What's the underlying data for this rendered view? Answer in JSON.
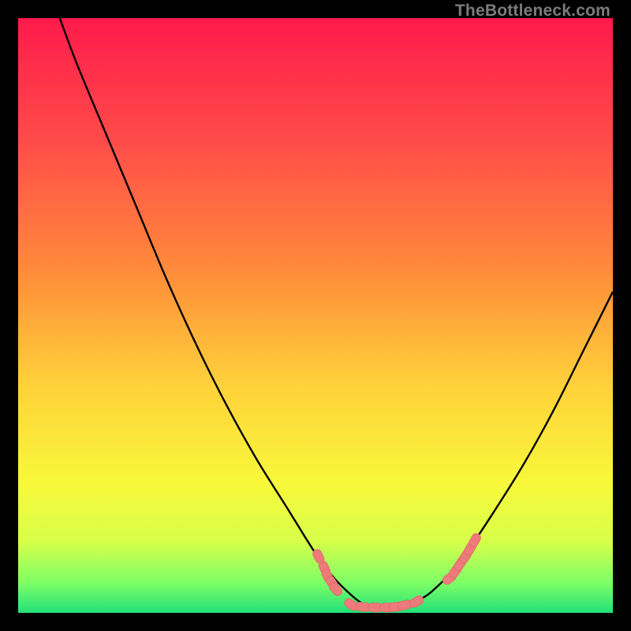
{
  "watermark": "TheBottleneck.com",
  "chart_data": {
    "type": "line",
    "title": "",
    "xlabel": "",
    "ylabel": "",
    "xlim": [
      0,
      100
    ],
    "ylim": [
      0,
      100
    ],
    "series": [
      {
        "name": "curve",
        "x": [
          7,
          10,
          15,
          20,
          25,
          30,
          35,
          40,
          45,
          50,
          53,
          56,
          58,
          60,
          62,
          65,
          68,
          70,
          73,
          76,
          80,
          85,
          90,
          95,
          100
        ],
        "y": [
          100,
          92,
          80,
          68,
          56,
          45,
          35,
          26,
          18,
          10,
          6,
          3,
          1.5,
          0.8,
          0.8,
          1.2,
          2.5,
          4,
          7,
          11,
          17,
          25,
          34,
          44,
          54
        ]
      }
    ],
    "marker_cluster": {
      "name": "dots",
      "points": [
        [
          50.5,
          9.5
        ],
        [
          51.5,
          7.5
        ],
        [
          52.0,
          6.2
        ],
        [
          52.8,
          5.0
        ],
        [
          53.4,
          4.0
        ],
        [
          56.0,
          1.4
        ],
        [
          58.0,
          1.0
        ],
        [
          60.0,
          0.9
        ],
        [
          62.0,
          0.9
        ],
        [
          63.5,
          1.0
        ],
        [
          65.0,
          1.3
        ],
        [
          67.0,
          1.9
        ],
        [
          72.5,
          5.8
        ],
        [
          73.5,
          7.0
        ],
        [
          74.3,
          8.2
        ],
        [
          75.2,
          9.5
        ],
        [
          76.0,
          10.8
        ],
        [
          76.8,
          12.2
        ]
      ]
    },
    "gradient_stops": [
      {
        "offset": 0.0,
        "color": "#ff1a4b"
      },
      {
        "offset": 0.2,
        "color": "#ff4a4a"
      },
      {
        "offset": 0.42,
        "color": "#ff8a3a"
      },
      {
        "offset": 0.62,
        "color": "#ffd23a"
      },
      {
        "offset": 0.78,
        "color": "#f8f83a"
      },
      {
        "offset": 0.88,
        "color": "#d8ff4a"
      },
      {
        "offset": 0.95,
        "color": "#7dff66"
      },
      {
        "offset": 1.0,
        "color": "#22e07a"
      }
    ],
    "colors": {
      "curve": "#000000",
      "marker_fill": "#ee7b7b",
      "marker_stroke": "#e46a6a"
    }
  }
}
